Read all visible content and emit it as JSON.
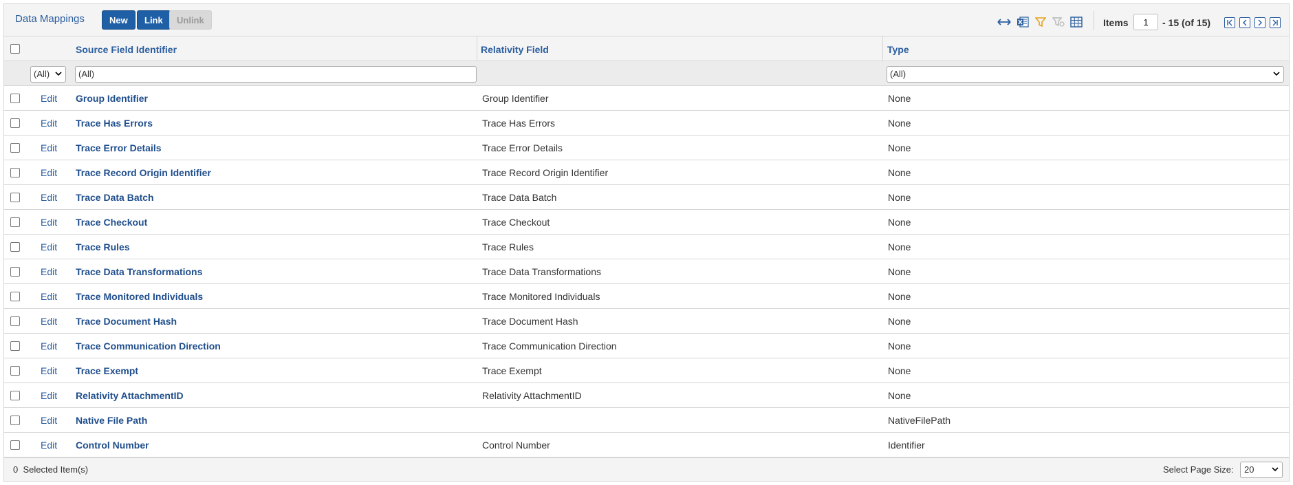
{
  "panel": {
    "title": "Data Mappings"
  },
  "toolbar": {
    "new_label": "New",
    "link_label": "Link",
    "unlink_label": "Unlink",
    "icons": [
      "expand-arrows-icon",
      "excel-export-icon",
      "filter-icon",
      "clear-filter-icon",
      "grid-columns-icon"
    ]
  },
  "pager": {
    "items_label": "Items",
    "current_page": "1",
    "range_text": "- 15 (of 15)"
  },
  "columns": {
    "source": "Source Field Identifier",
    "relativity": "Relativity Field",
    "type": "Type"
  },
  "filters": {
    "edit_filter": "(All)",
    "source_filter": "(All)",
    "type_filter": "(All)"
  },
  "rows": [
    {
      "edit": "Edit",
      "source": "Group Identifier",
      "relativity": "Group Identifier",
      "type": "None"
    },
    {
      "edit": "Edit",
      "source": "Trace Has Errors",
      "relativity": "Trace Has Errors",
      "type": "None"
    },
    {
      "edit": "Edit",
      "source": "Trace Error Details",
      "relativity": "Trace Error Details",
      "type": "None"
    },
    {
      "edit": "Edit",
      "source": "Trace Record Origin Identifier",
      "relativity": "Trace Record Origin Identifier",
      "type": "None"
    },
    {
      "edit": "Edit",
      "source": "Trace Data Batch",
      "relativity": "Trace Data Batch",
      "type": "None"
    },
    {
      "edit": "Edit",
      "source": "Trace Checkout",
      "relativity": "Trace Checkout",
      "type": "None"
    },
    {
      "edit": "Edit",
      "source": "Trace Rules",
      "relativity": "Trace Rules",
      "type": "None"
    },
    {
      "edit": "Edit",
      "source": "Trace Data Transformations",
      "relativity": "Trace Data Transformations",
      "type": "None"
    },
    {
      "edit": "Edit",
      "source": "Trace Monitored Individuals",
      "relativity": "Trace Monitored Individuals",
      "type": "None"
    },
    {
      "edit": "Edit",
      "source": "Trace Document Hash",
      "relativity": "Trace Document Hash",
      "type": "None"
    },
    {
      "edit": "Edit",
      "source": "Trace Communication Direction",
      "relativity": "Trace Communication Direction",
      "type": "None"
    },
    {
      "edit": "Edit",
      "source": "Trace Exempt",
      "relativity": "Trace Exempt",
      "type": "None"
    },
    {
      "edit": "Edit",
      "source": "Relativity AttachmentID",
      "relativity": "Relativity AttachmentID",
      "type": "None"
    },
    {
      "edit": "Edit",
      "source": "Native File Path",
      "relativity": "",
      "type": "NativeFilePath"
    },
    {
      "edit": "Edit",
      "source": "Control Number",
      "relativity": "Control Number",
      "type": "Identifier"
    }
  ],
  "footer": {
    "selected_count": "0",
    "selected_label": "Selected Item(s)",
    "page_size_label": "Select Page Size:",
    "page_size_value": "20"
  },
  "colors": {
    "accent": "#1f5fa6",
    "link": "#2a5d9f",
    "header_bg": "#f4f4f4"
  }
}
